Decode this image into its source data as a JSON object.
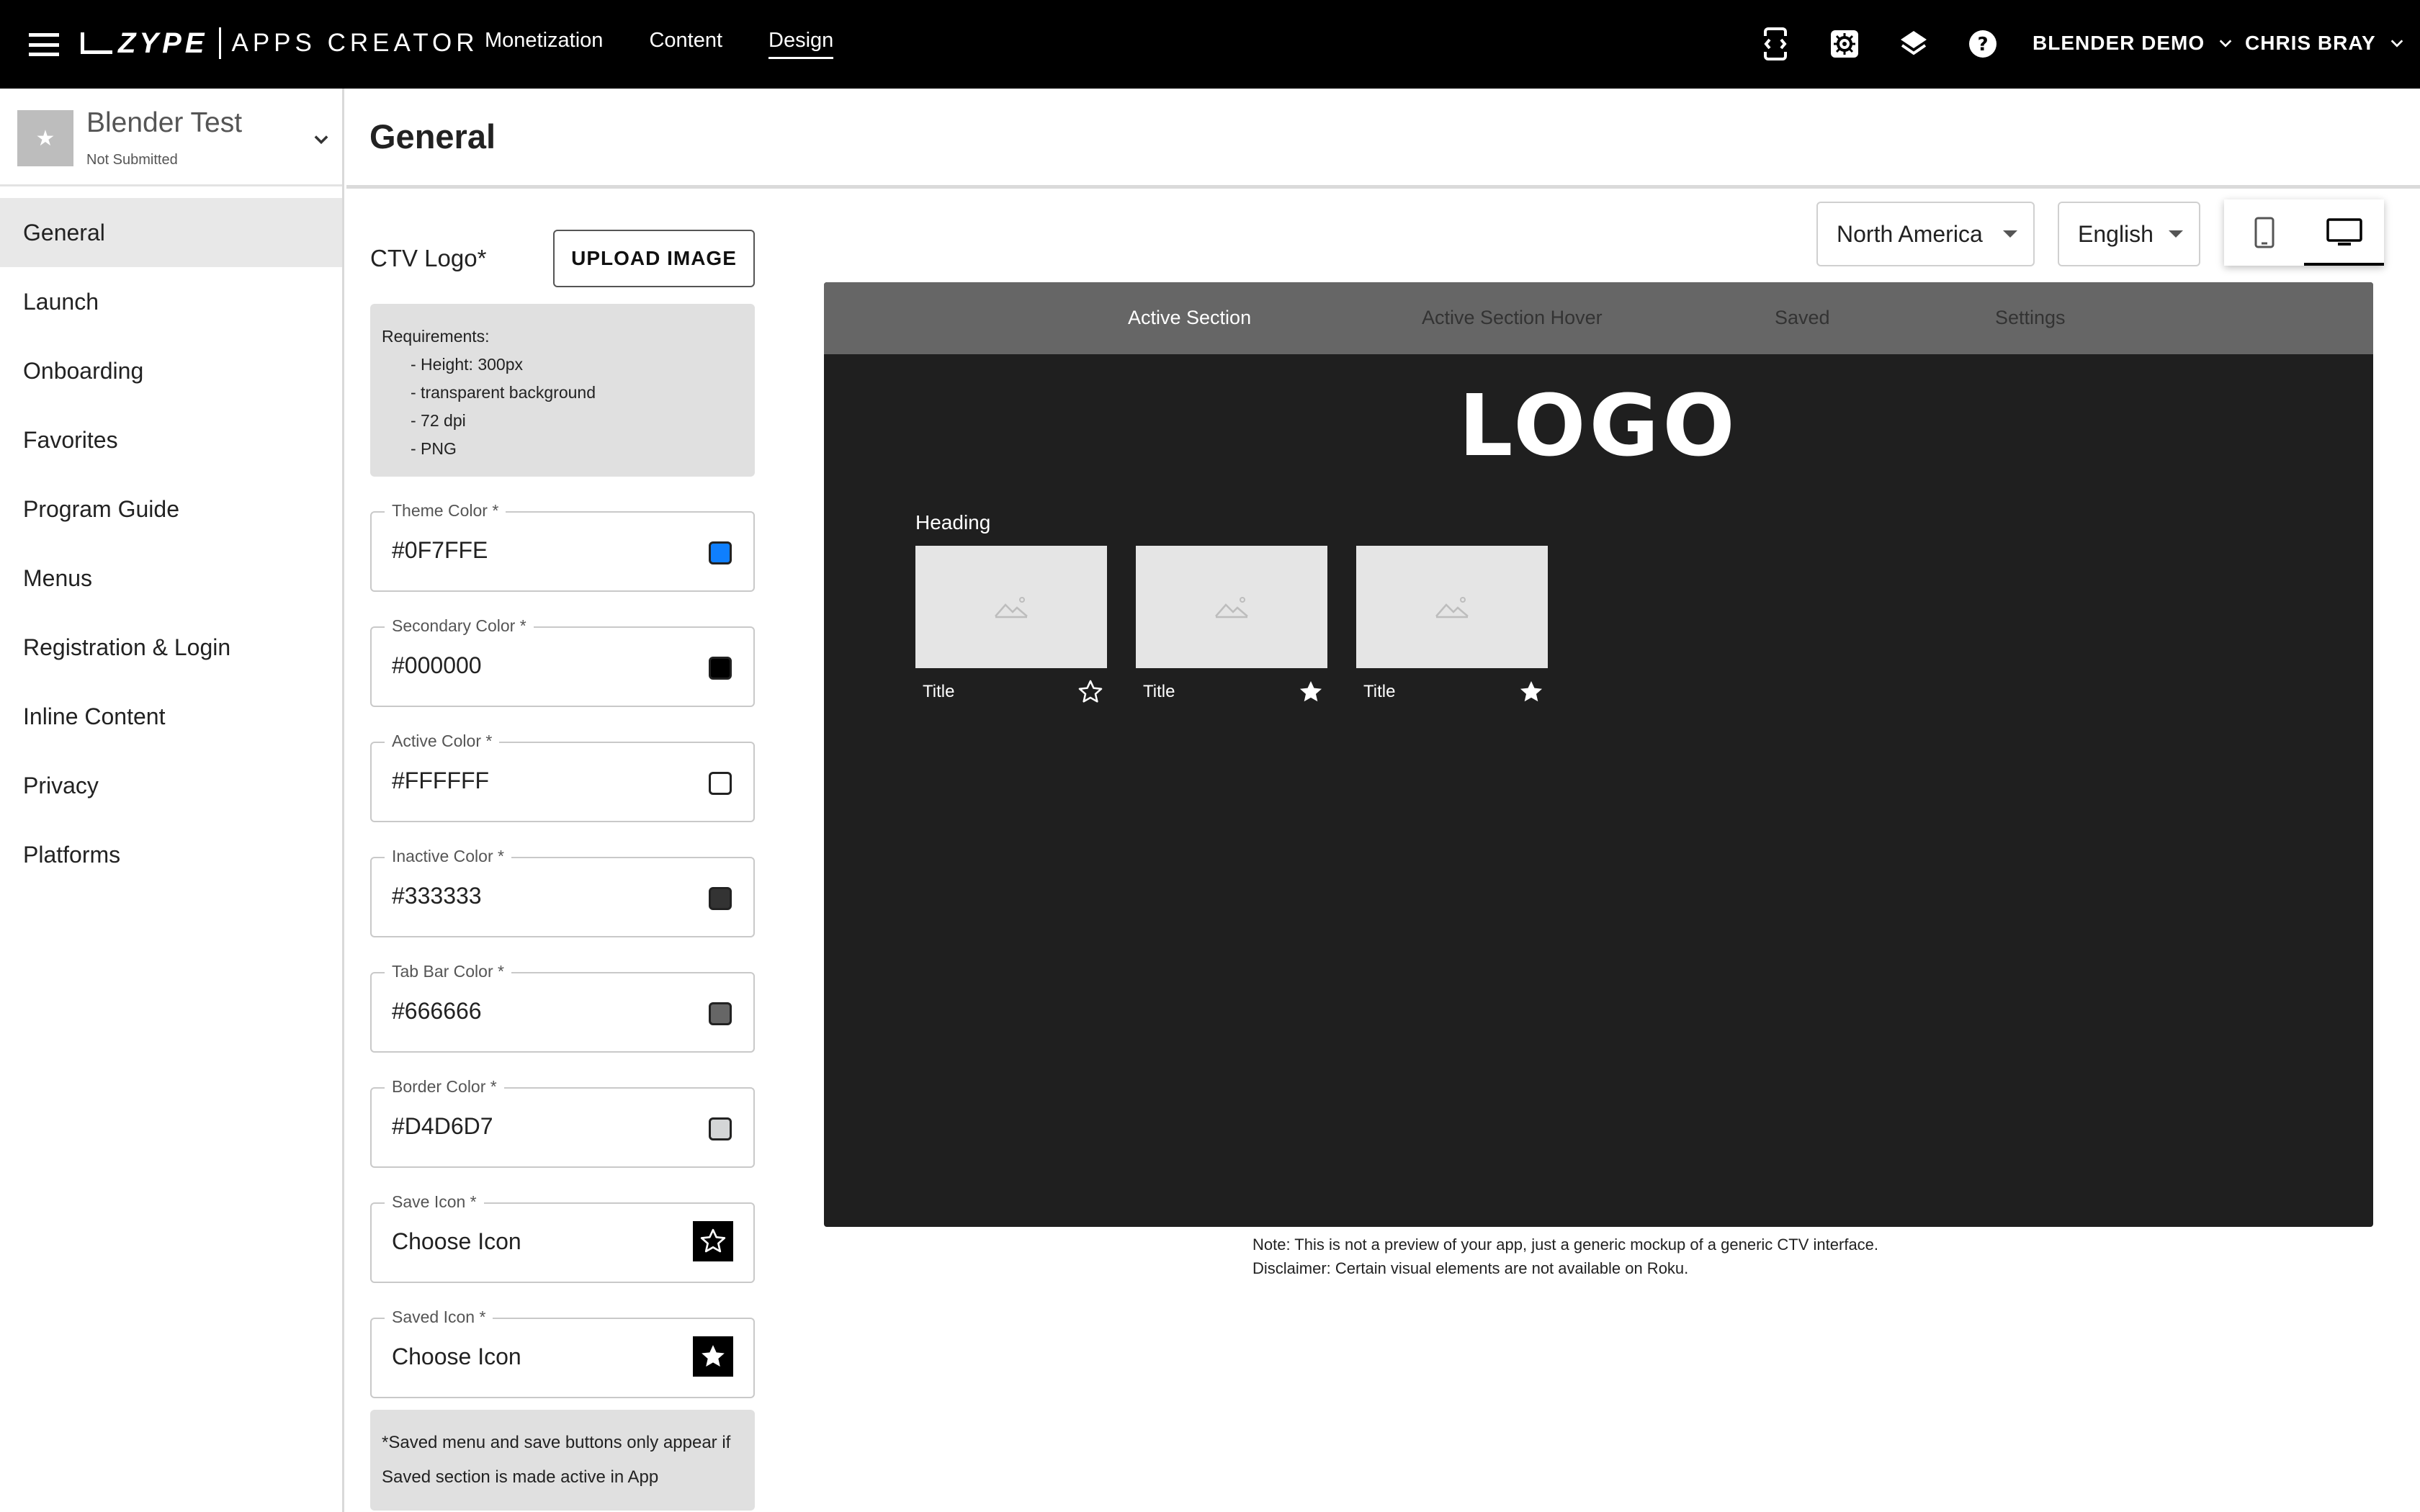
{
  "topbar": {
    "brand": {
      "name": "ZYPE",
      "product": "APPS CREATOR"
    },
    "nav": [
      {
        "label": "Monetization",
        "active": false
      },
      {
        "label": "Content",
        "active": false
      },
      {
        "label": "Design",
        "active": true
      }
    ],
    "icons": [
      "preview-code-icon",
      "settings-icon",
      "layers-icon",
      "help-icon"
    ],
    "org": "BLENDER DEMO",
    "user": "CHRIS BRAY"
  },
  "app": {
    "name": "Blender Test",
    "status": "Not Submitted"
  },
  "sidebar": {
    "items": [
      {
        "label": "General",
        "active": true
      },
      {
        "label": "Launch"
      },
      {
        "label": "Onboarding"
      },
      {
        "label": "Favorites"
      },
      {
        "label": "Program Guide"
      },
      {
        "label": "Menus"
      },
      {
        "label": "Registration & Login"
      },
      {
        "label": "Inline Content"
      },
      {
        "label": "Privacy"
      },
      {
        "label": "Platforms"
      }
    ]
  },
  "page": {
    "title": "General"
  },
  "form": {
    "ctv_logo_label": "CTV Logo*",
    "upload_button": "UPLOAD IMAGE",
    "requirements": {
      "heading": "Requirements:",
      "items": [
        "- Height: 300px",
        "- transparent background",
        "- 72 dpi",
        "- PNG"
      ]
    },
    "fields": [
      {
        "label": "Theme Color *",
        "value": "#0F7FFE",
        "swatch": "#0F7FFE",
        "kind": "color"
      },
      {
        "label": "Secondary Color *",
        "value": "#000000",
        "swatch": "#000000",
        "kind": "color"
      },
      {
        "label": "Active Color *",
        "value": "#FFFFFF",
        "swatch": "#FFFFFF",
        "kind": "color"
      },
      {
        "label": "Inactive Color *",
        "value": "#333333",
        "swatch": "#333333",
        "kind": "color"
      },
      {
        "label": "Tab Bar Color *",
        "value": "#666666",
        "swatch": "#666666",
        "kind": "color"
      },
      {
        "label": "Border Color *",
        "value": "#D4D6D7",
        "swatch": "#D4D6D7",
        "kind": "color"
      },
      {
        "label": "Save Icon *",
        "value": "Choose Icon",
        "icon": "star-outline-icon",
        "kind": "icon"
      },
      {
        "label": "Saved Icon *",
        "value": "Choose Icon",
        "icon": "star-filled-icon",
        "kind": "icon"
      }
    ],
    "saved_note": "*Saved menu and save buttons only appear if Saved section is made active in App"
  },
  "preview": {
    "region": "North America",
    "language": "English",
    "device_options": [
      "phone-icon",
      "tv-icon"
    ],
    "device_selected": "tv-icon",
    "ctv": {
      "tabs": [
        {
          "label": "Active Section",
          "color": "#FFFFFF"
        },
        {
          "label": "Active Section Hover",
          "color": "#333333"
        },
        {
          "label": "Saved",
          "color": "#333333"
        },
        {
          "label": "Settings",
          "color": "#333333"
        }
      ],
      "tab_bar_color": "#666666",
      "background": "#1F1F1F",
      "logo": "LOGO",
      "heading": "Heading",
      "cards": [
        {
          "title": "Title",
          "saved": false
        },
        {
          "title": "Title",
          "saved": true
        },
        {
          "title": "Title",
          "saved": true
        }
      ]
    },
    "note": "Note: This is not a preview of your app, just a generic mockup of a generic CTV interface.",
    "disclaimer": "Disclaimer: Certain visual elements are not available on Roku."
  }
}
